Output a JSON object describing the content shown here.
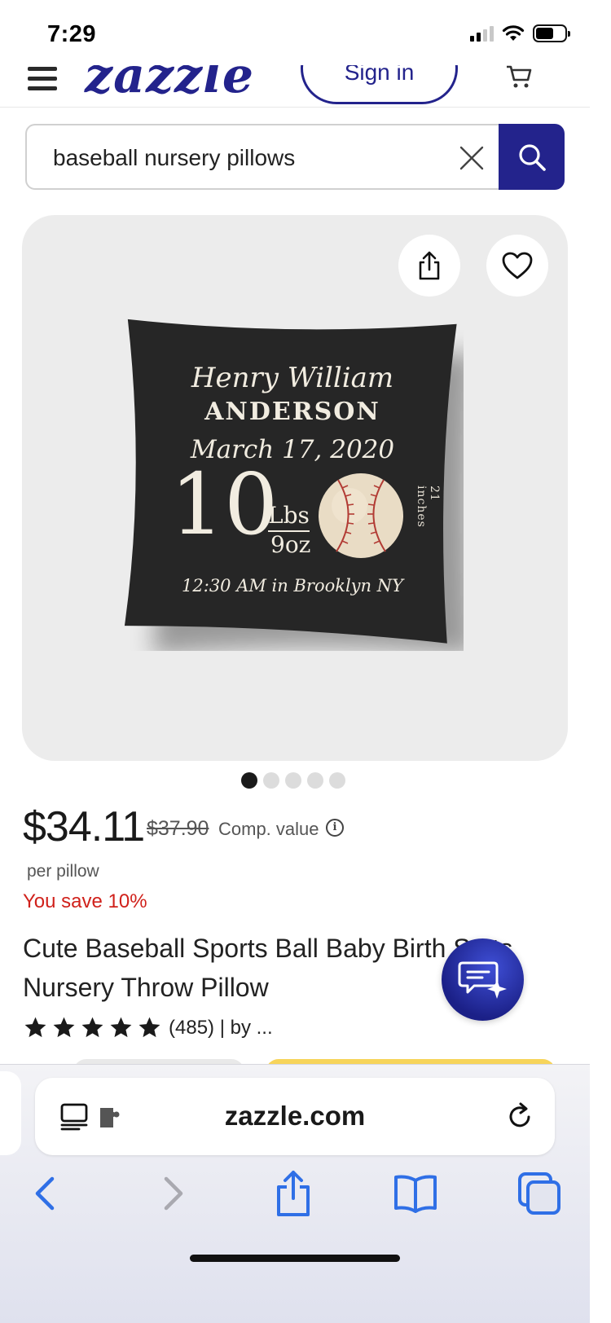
{
  "status": {
    "time": "7:29"
  },
  "header": {
    "logo": "zazzle",
    "sign_in_label": "Sign in"
  },
  "search": {
    "query": "baseball nursery pillows"
  },
  "product": {
    "pillow_design": {
      "first_middle": "Henry William",
      "last_name": "ANDERSON",
      "date": "March 17, 2020",
      "weight_lbs": "10",
      "lbs_label": "Lbs",
      "oz": "9oz",
      "time_place": "12:30 AM in Brooklyn NY",
      "length": "21 inches"
    },
    "image_count": 5,
    "active_image_index": 0,
    "price": "$34.11",
    "original_price": "$37.90",
    "comp_value_label": "Comp. value",
    "per_unit": "per pillow",
    "savings": "You save 10%",
    "title": "Cute Baseball Sports Ball Baby Birth Stats Nursery Throw Pillow",
    "rating_stars": 5,
    "rating_text": "(485) | by ..."
  },
  "browser": {
    "url": "zazzle.com"
  },
  "colors": {
    "brand": "#23238c",
    "sale": "#d0211b",
    "safari_blue": "#2f6fe6"
  }
}
